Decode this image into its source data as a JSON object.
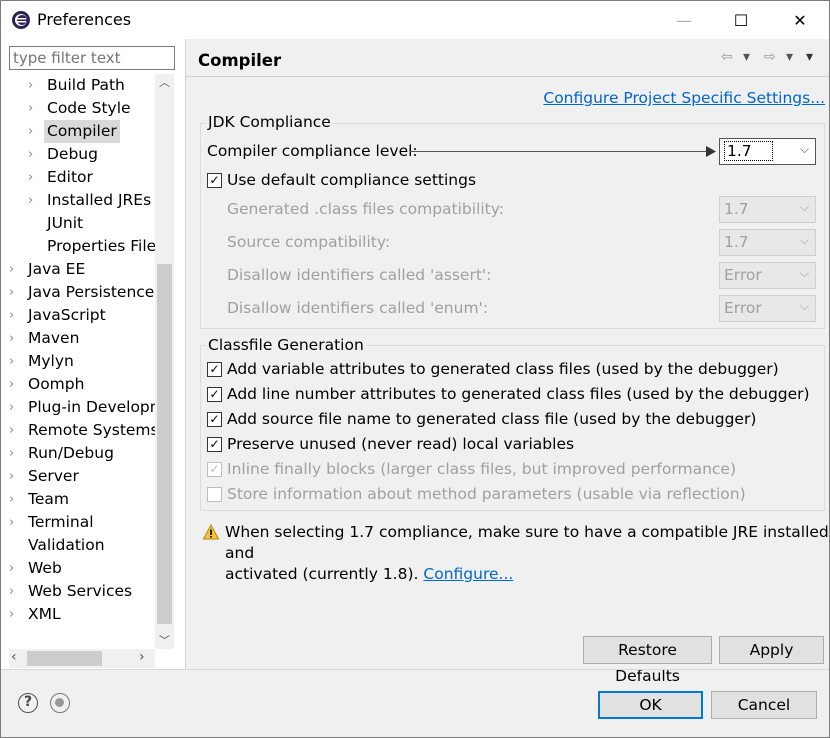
{
  "window": {
    "title": "Preferences",
    "minimize": "—",
    "maximize": "☐",
    "close": "✕"
  },
  "filter": {
    "placeholder": "type filter text"
  },
  "tree": {
    "items": [
      {
        "label": "Build Path",
        "arrow": "›",
        "indent": 2
      },
      {
        "label": "Code Style",
        "arrow": "›",
        "indent": 2
      },
      {
        "label": "Compiler",
        "arrow": "›",
        "indent": 2,
        "selected": true
      },
      {
        "label": "Debug",
        "arrow": "›",
        "indent": 2
      },
      {
        "label": "Editor",
        "arrow": "›",
        "indent": 2
      },
      {
        "label": "Installed JREs",
        "arrow": "›",
        "indent": 2
      },
      {
        "label": "JUnit",
        "arrow": "",
        "indent": 2
      },
      {
        "label": "Properties Files Editor",
        "arrow": "",
        "indent": 2
      },
      {
        "label": "Java EE",
        "arrow": "›",
        "indent": 1
      },
      {
        "label": "Java Persistence",
        "arrow": "›",
        "indent": 1
      },
      {
        "label": "JavaScript",
        "arrow": "›",
        "indent": 1
      },
      {
        "label": "Maven",
        "arrow": "›",
        "indent": 1
      },
      {
        "label": "Mylyn",
        "arrow": "›",
        "indent": 1
      },
      {
        "label": "Oomph",
        "arrow": "›",
        "indent": 1
      },
      {
        "label": "Plug-in Development",
        "arrow": "›",
        "indent": 1
      },
      {
        "label": "Remote Systems",
        "arrow": "›",
        "indent": 1
      },
      {
        "label": "Run/Debug",
        "arrow": "›",
        "indent": 1
      },
      {
        "label": "Server",
        "arrow": "›",
        "indent": 1
      },
      {
        "label": "Team",
        "arrow": "›",
        "indent": 1
      },
      {
        "label": "Terminal",
        "arrow": "›",
        "indent": 1
      },
      {
        "label": "Validation",
        "arrow": "",
        "indent": 1
      },
      {
        "label": "Web",
        "arrow": "›",
        "indent": 1
      },
      {
        "label": "Web Services",
        "arrow": "›",
        "indent": 1
      },
      {
        "label": "XML",
        "arrow": "›",
        "indent": 1
      }
    ]
  },
  "page": {
    "title": "Compiler",
    "nav": {
      "back": "⇦",
      "back_menu": "▾",
      "forward": "⇨",
      "forward_menu": "▾",
      "view_menu": "▾"
    },
    "configure_link": "Configure Project Specific Settings..."
  },
  "jdk": {
    "group_title": "JDK Compliance",
    "level_label": "Compiler compliance level:",
    "level_value": "1.7",
    "use_default_label": "Use default compliance settings",
    "use_default_checked": true,
    "rows": [
      {
        "label": "Generated .class files compatibility:",
        "value": "1.7"
      },
      {
        "label": "Source compatibility:",
        "value": "1.7"
      },
      {
        "label": "Disallow identifiers called 'assert':",
        "value": "Error"
      },
      {
        "label": "Disallow identifiers called 'enum':",
        "value": "Error"
      }
    ]
  },
  "classfile": {
    "group_title": "Classfile Generation",
    "options": [
      {
        "label": "Add variable attributes to generated class files (used by the debugger)",
        "checked": true,
        "enabled": true
      },
      {
        "label": "Add line number attributes to generated class files (used by the debugger)",
        "checked": true,
        "enabled": true
      },
      {
        "label": "Add source file name to generated class file (used by the debugger)",
        "checked": true,
        "enabled": true
      },
      {
        "label": "Preserve unused (never read) local variables",
        "checked": true,
        "enabled": true
      },
      {
        "label": "Inline finally blocks (larger class files, but improved performance)",
        "checked": true,
        "enabled": false
      },
      {
        "label": "Store information about method parameters (usable via reflection)",
        "checked": false,
        "enabled": false
      }
    ]
  },
  "warning": {
    "line1": "When selecting 1.7 compliance, make sure to have a compatible JRE installed and",
    "line2": "activated (currently 1.8).",
    "link": "Configure..."
  },
  "buttons": {
    "restore_defaults": "Restore Defaults",
    "apply": "Apply",
    "ok": "OK",
    "cancel": "Cancel"
  },
  "checkmark": "✓",
  "chevron": "⌵",
  "help": "?"
}
